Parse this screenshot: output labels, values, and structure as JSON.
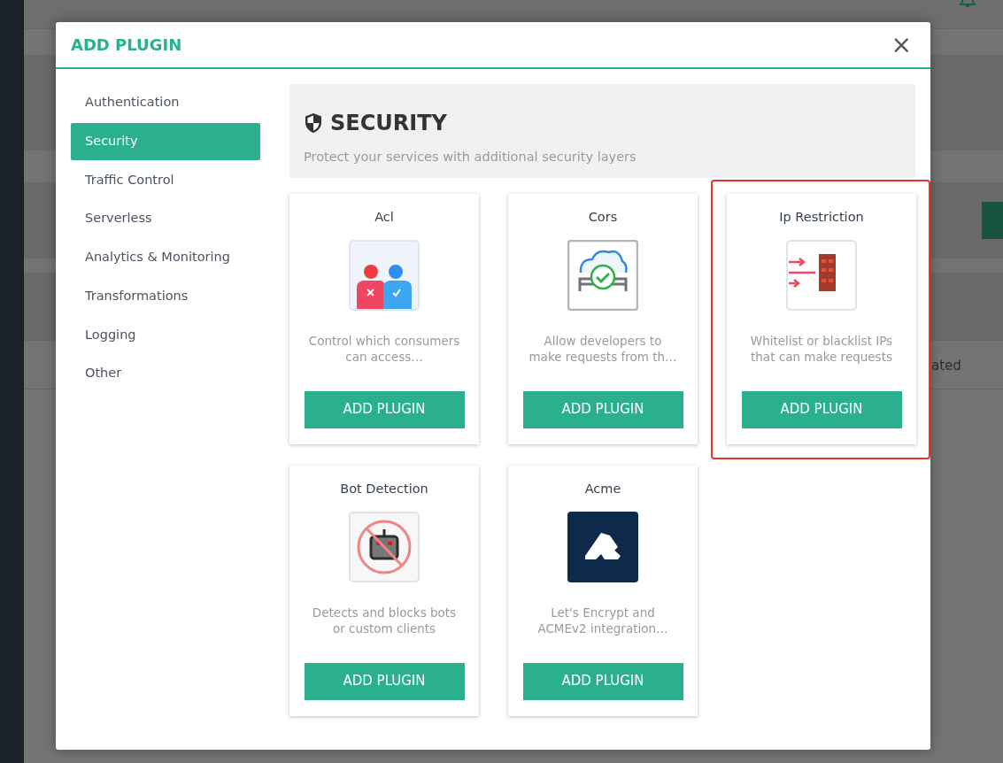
{
  "background": {
    "column_text": "ated"
  },
  "modal": {
    "title": "ADD PLUGIN",
    "close": "×"
  },
  "categories": [
    {
      "label": "Authentication",
      "selected": false
    },
    {
      "label": "Security",
      "selected": true
    },
    {
      "label": "Traffic Control",
      "selected": false
    },
    {
      "label": "Serverless",
      "selected": false
    },
    {
      "label": "Analytics & Monitoring",
      "selected": false
    },
    {
      "label": "Transformations",
      "selected": false
    },
    {
      "label": "Logging",
      "selected": false
    },
    {
      "label": "Other",
      "selected": false
    }
  ],
  "section": {
    "title": "SECURITY",
    "description": "Protect your services with additional security layers"
  },
  "plugins": [
    {
      "name": "Acl",
      "description": "Control which consumers can access…",
      "button": "ADD PLUGIN",
      "highlighted": false
    },
    {
      "name": "Cors",
      "description": "Allow developers to make requests from th…",
      "button": "ADD PLUGIN",
      "highlighted": false
    },
    {
      "name": "Ip Restriction",
      "description": "Whitelist or blacklist IPs that can make requests",
      "button": "ADD PLUGIN",
      "highlighted": true
    },
    {
      "name": "Bot Detection",
      "description": "Detects and blocks bots or custom clients",
      "button": "ADD PLUGIN",
      "highlighted": false
    },
    {
      "name": "Acme",
      "description": "Let's Encrypt and ACMEv2 integration…",
      "button": "ADD PLUGIN",
      "highlighted": false
    }
  ]
}
